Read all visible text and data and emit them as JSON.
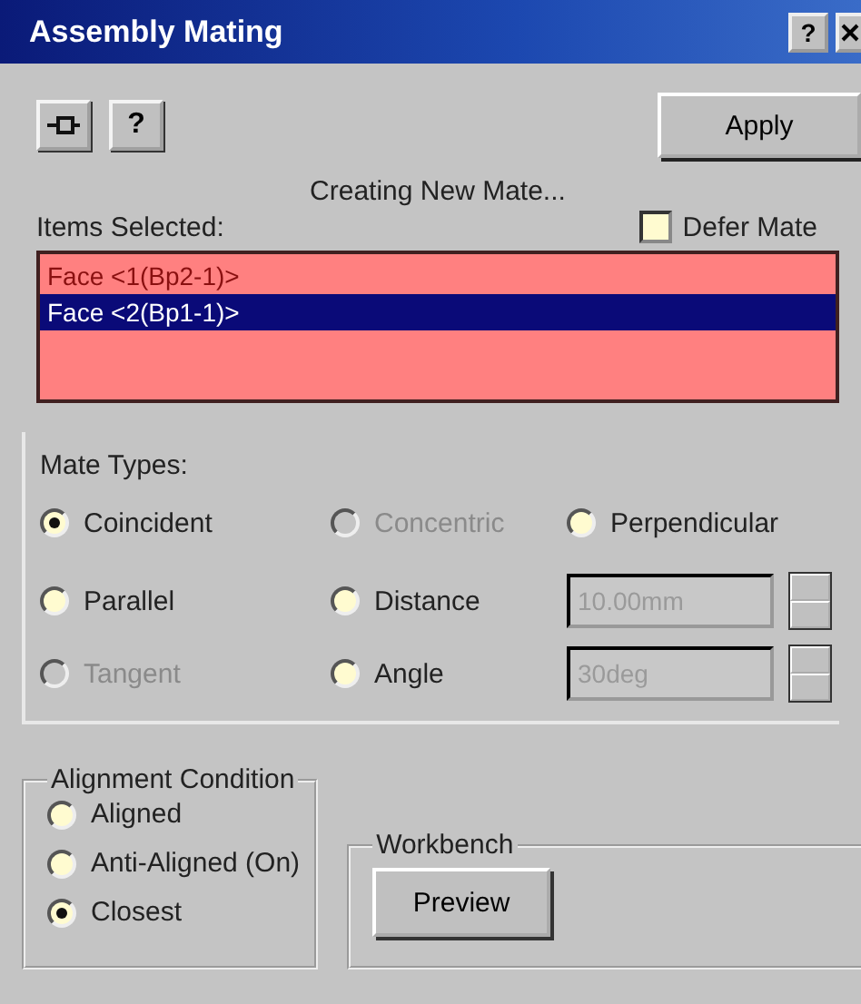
{
  "window": {
    "title": "Assembly Mating",
    "help_button": "?"
  },
  "toolbar": {
    "help_button": "?"
  },
  "apply_button": "Apply",
  "status": "Creating New Mate...",
  "items_label": "Items Selected:",
  "defer_mate": {
    "label": "Defer Mate",
    "checked": false
  },
  "items": [
    {
      "label": "Face <1(Bp2-1)>",
      "selected": false
    },
    {
      "label": "Face <2(Bp1-1)>",
      "selected": true
    }
  ],
  "mate_types": {
    "title": "Mate Types:",
    "rows": [
      {
        "options": [
          {
            "label": "Coincident",
            "selected": true,
            "disabled": false
          },
          {
            "label": "Concentric",
            "selected": false,
            "disabled": true
          },
          {
            "label": "Perpendicular",
            "selected": false,
            "disabled": false
          }
        ]
      },
      {
        "options": [
          {
            "label": "Parallel",
            "selected": false,
            "disabled": false
          },
          {
            "label": "Distance",
            "selected": false,
            "disabled": false
          }
        ],
        "field": {
          "value": "10.00mm",
          "disabled": true
        }
      },
      {
        "options": [
          {
            "label": "Tangent",
            "selected": false,
            "disabled": true
          },
          {
            "label": "Angle",
            "selected": false,
            "disabled": false
          }
        ],
        "field": {
          "value": "30deg",
          "disabled": true
        }
      }
    ]
  },
  "alignment": {
    "title": "Alignment Condition",
    "options": [
      {
        "label": "Aligned",
        "selected": false
      },
      {
        "label": "Anti-Aligned (On)",
        "selected": false
      },
      {
        "label": "Closest",
        "selected": true
      }
    ]
  },
  "workbench": {
    "title": "Workbench",
    "button": "Preview"
  }
}
